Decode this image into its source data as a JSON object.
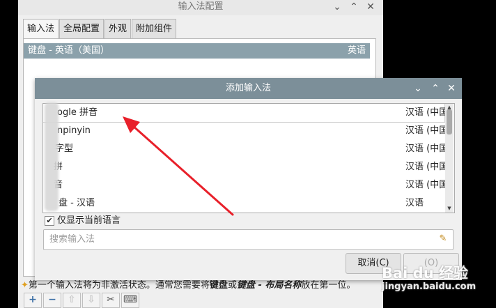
{
  "main": {
    "title": "输入法配置",
    "tabs": [
      "输入法",
      "全局配置",
      "外观",
      "附加组件"
    ],
    "active_tab": "输入法",
    "current_im": {
      "name": "键盘 - 英语（美国）",
      "lang": "英语"
    },
    "hint": {
      "pre": "第一个输入法将为非激活状态。通常您需要将",
      "b1": "键盘",
      "mid": "或",
      "b2": "键盘 - 布局名称",
      "post": "放在第一位。"
    },
    "toolbar": [
      "add-icon",
      "remove-icon",
      "move-up-icon",
      "move-down-icon",
      "configure-icon",
      "keyboard-icon"
    ]
  },
  "dialog": {
    "title": "添加输入法",
    "items": [
      {
        "name": "ogle 拼音",
        "lang": "汉语 (中国"
      },
      {
        "name": "npinyin",
        "lang": "汉语 (中国"
      },
      {
        "name": "字型",
        "lang": "汉语 (中国"
      },
      {
        "name": "拼",
        "lang": "汉语 (中国"
      },
      {
        "name": "音",
        "lang": "汉语 (中国"
      },
      {
        "name": "盘 - 汉语",
        "lang": "汉语"
      }
    ],
    "only_current_lang": {
      "label": "仅显示当前语言",
      "checked": true,
      "mark": "✔"
    },
    "search": {
      "value": "",
      "placeholder": "搜索输入法"
    },
    "cancel_label": "取消(C)",
    "ok_label": "(O)"
  },
  "window_controls": {
    "minimize": "⌄",
    "maximize": "⌃",
    "close": "✕"
  },
  "watermark": {
    "brand": "Bai du 经验",
    "url": "jingyan.baidu.com"
  },
  "colors": {
    "selection": "#8ba1ab",
    "dialog_titlebar": "#7c8f99",
    "arrow": "#e8202a"
  }
}
